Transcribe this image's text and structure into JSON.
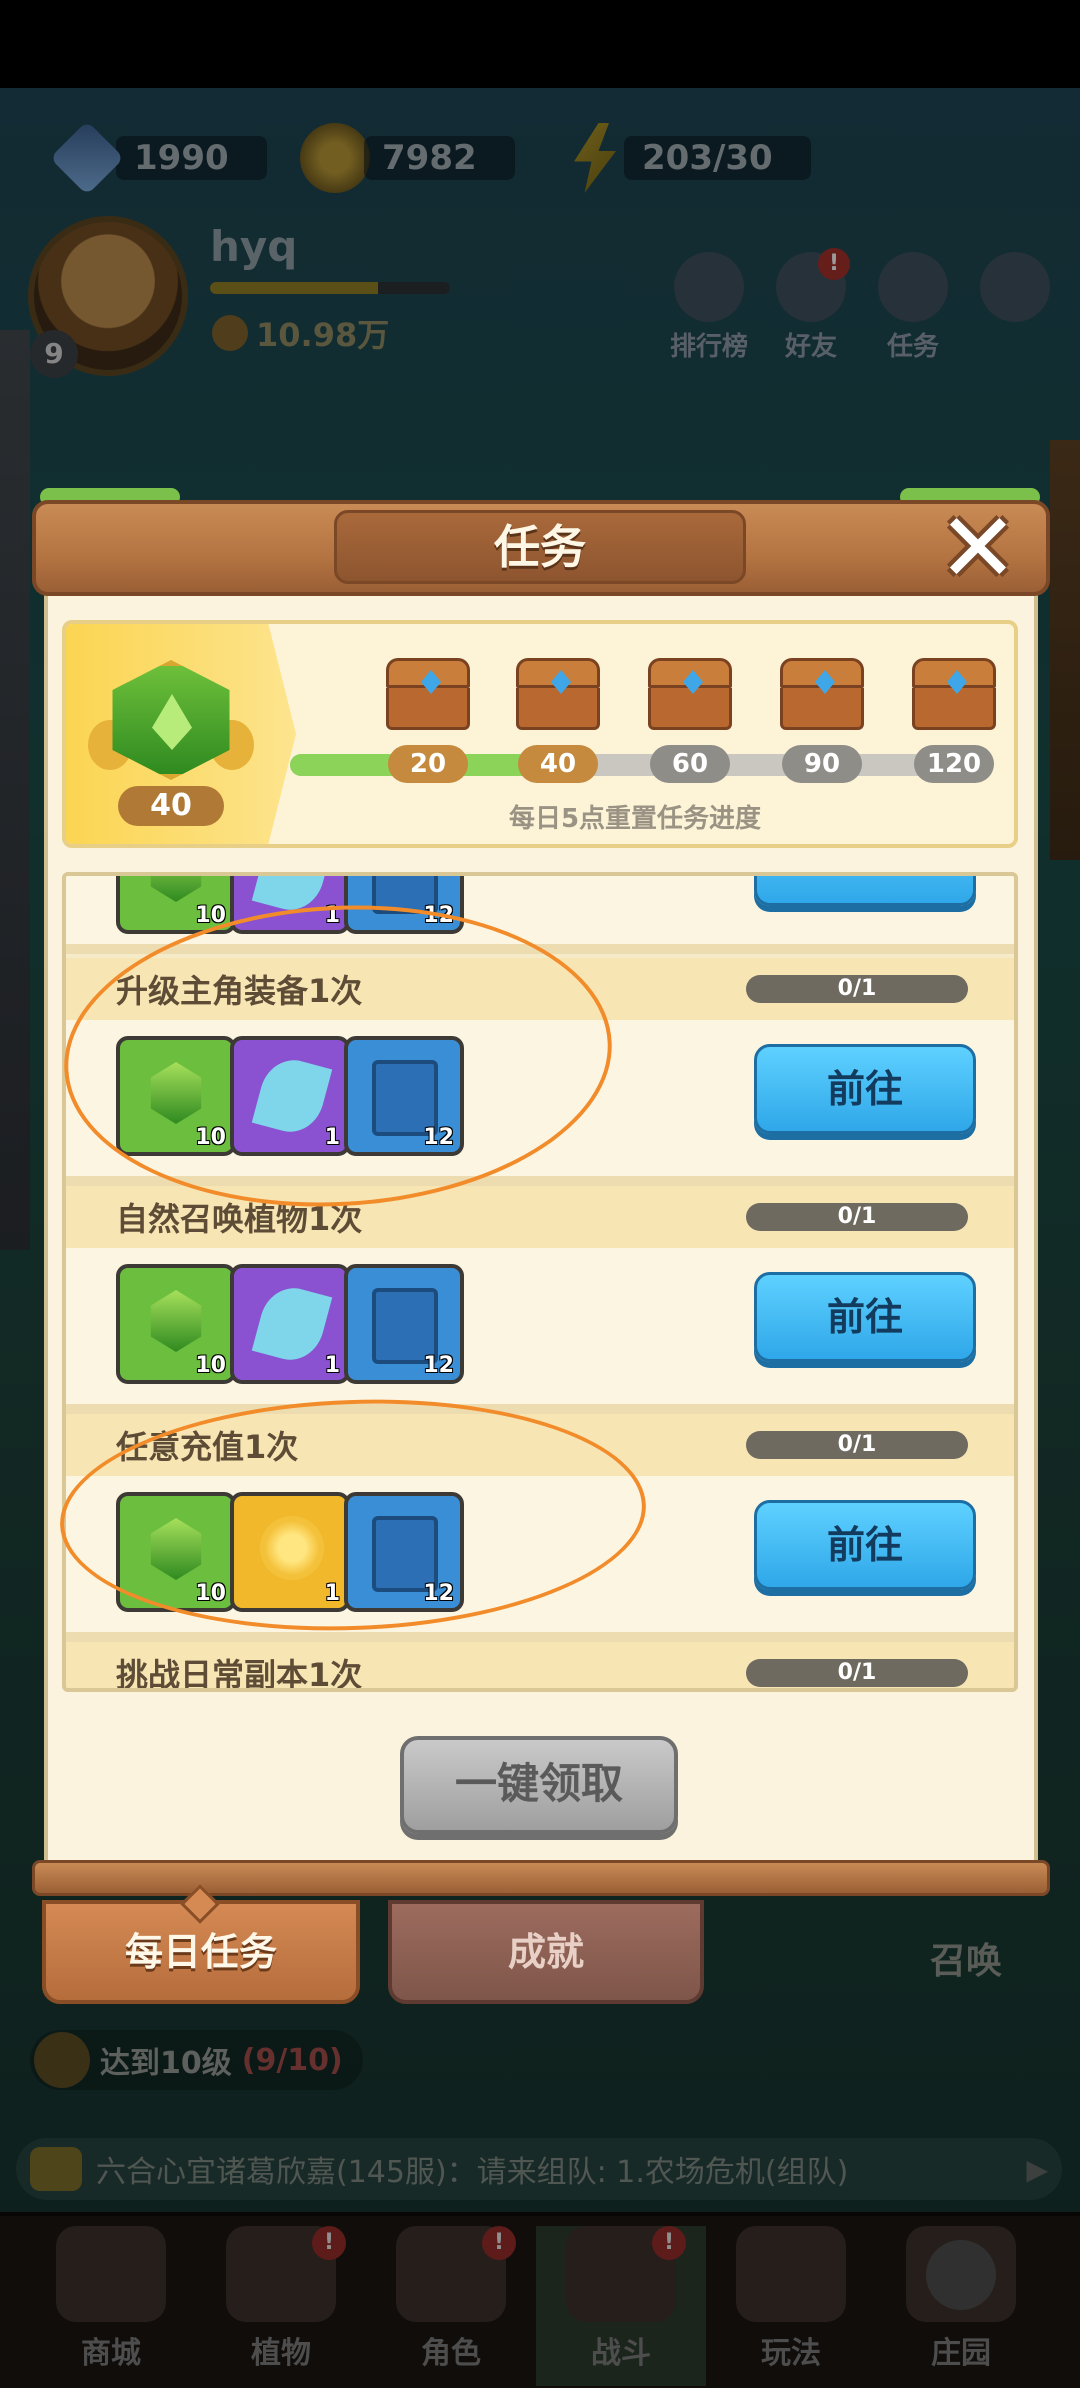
{
  "resources": {
    "gems": "1990",
    "coins": "7982",
    "energy": "203/30"
  },
  "player": {
    "name": "hyq",
    "level": "9",
    "power": "10.98万"
  },
  "top_buttons": {
    "rank": "排行榜",
    "friends": "好友",
    "tasks": "任务",
    "friends_badge": "!"
  },
  "dialog": {
    "title": "任务",
    "close": "✕",
    "progress": {
      "points": "40",
      "current": 40,
      "max": 120,
      "milestones": [
        "20",
        "40",
        "60",
        "90",
        "120"
      ],
      "reset_note": "每日5点重置任务进度"
    },
    "tasks": [
      {
        "title": "升级主角装备1次",
        "progress": "0/1",
        "rewards": [
          {
            "type": "green",
            "count": "10"
          },
          {
            "type": "purple",
            "count": "1"
          },
          {
            "type": "blue",
            "count": "12"
          }
        ],
        "button": "前往"
      },
      {
        "title": "自然召唤植物1次",
        "progress": "0/1",
        "rewards": [
          {
            "type": "green",
            "count": "10"
          },
          {
            "type": "purple",
            "count": "1"
          },
          {
            "type": "blue",
            "count": "12"
          }
        ],
        "button": "前往"
      },
      {
        "title": "任意充值1次",
        "progress": "0/1",
        "rewards": [
          {
            "type": "green",
            "count": "10"
          },
          {
            "type": "gold",
            "count": "1"
          },
          {
            "type": "blue",
            "count": "12"
          }
        ],
        "button": "前往"
      },
      {
        "title": "挑战日常副本1次",
        "progress": "0/1"
      }
    ],
    "partial_top": {
      "counts": [
        "10",
        "1",
        "12"
      ]
    },
    "claim_all": "一键领取"
  },
  "tabs": {
    "daily": "每日任务",
    "achievements": "成就"
  },
  "summon_label": "召唤",
  "quest": {
    "text": "达到10级",
    "progress": "(9/10)"
  },
  "chat": {
    "text": "六合心宜诸葛欣嘉(145服)：请来组队: 1.农场危机(组队)",
    "arrow": "▶"
  },
  "nav": [
    {
      "label": "商城",
      "badge": ""
    },
    {
      "label": "植物",
      "badge": "!"
    },
    {
      "label": "角色",
      "badge": "!"
    },
    {
      "label": "战斗",
      "badge": "!"
    },
    {
      "label": "玩法",
      "badge": ""
    },
    {
      "label": "庄园",
      "badge": ""
    }
  ],
  "colors": {
    "accent_blue": "#2fa7e9",
    "progress_green": "#8cd35a",
    "wood": "#b47442",
    "annotation": "#f28c2a"
  }
}
